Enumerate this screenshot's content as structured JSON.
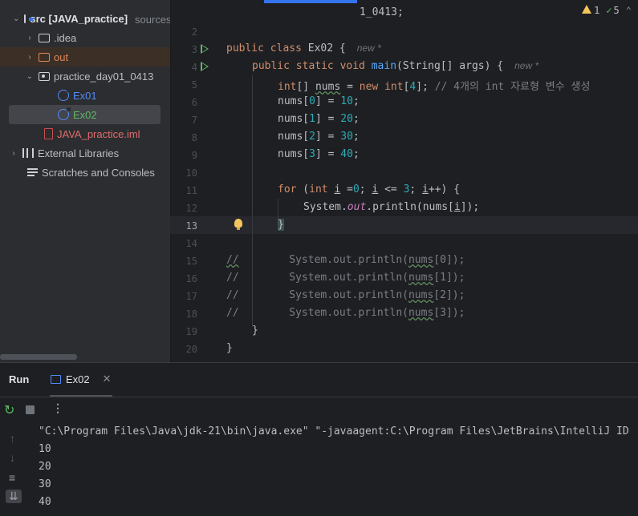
{
  "project_tree": {
    "items": [
      {
        "label": "src [JAVA_practice]",
        "extra": "sources root,  C:\\박세현\\JAVA_practice\\src",
        "type": "src-folder",
        "expanded": true
      },
      {
        "label": ".idea",
        "type": "folder",
        "expanded": false
      },
      {
        "label": "out",
        "type": "excluded-folder",
        "expanded": false
      },
      {
        "label": "practice_day01_0413",
        "type": "package",
        "expanded": true
      },
      {
        "label": "Ex01",
        "type": "class"
      },
      {
        "label": "Ex02",
        "type": "class",
        "selected": true
      },
      {
        "label": "JAVA_practice.iml",
        "type": "iml"
      },
      {
        "label": "External Libraries",
        "type": "libraries",
        "expanded": false
      },
      {
        "label": "Scratches and Consoles",
        "type": "scratches"
      }
    ]
  },
  "editor": {
    "partial_top_text": "1_0413;",
    "warnings": {
      "count": "1",
      "ok_count": "5"
    },
    "current_line": 13,
    "line_numbers": [
      "2",
      "3",
      "4",
      "5",
      "6",
      "7",
      "8",
      "9",
      "10",
      "11",
      "12",
      "13",
      "14",
      "15",
      "16",
      "17",
      "18",
      "19",
      "20"
    ],
    "hints": {
      "class_new": "new *",
      "main_new": "new *"
    },
    "code": {
      "l3_kw": "public class",
      "l3_name": " Ex02 {",
      "l4_kw1": "public static void",
      "l4_fn": "main",
      "l4_rest": "(String[] args) {",
      "l5_type": "int",
      "l5_a": "[] ",
      "l5_var": "nums",
      "l5_b": " = ",
      "l5_new": "new",
      "l5_int": "int",
      "l5_c": "[",
      "l5_num": "4",
      "l5_d": "]; ",
      "l5_cmt": "// 4개의 int 자료형 변수 생성",
      "l6_a": "nums[",
      "l6_i": "0",
      "l6_b": "] = ",
      "l6_v": "10",
      "l6_c": ";",
      "l7_a": "nums[",
      "l7_i": "1",
      "l7_b": "] = ",
      "l7_v": "20",
      "l7_c": ";",
      "l8_a": "nums[",
      "l8_i": "2",
      "l8_b": "] = ",
      "l8_v": "30",
      "l8_c": ";",
      "l9_a": "nums[",
      "l9_i": "3",
      "l9_b": "] = ",
      "l9_v": "40",
      "l9_c": ";",
      "l11_for": "for",
      "l11_a": " (",
      "l11_int": "int",
      "l11_b": " ",
      "l11_i1": "i",
      "l11_c": " =",
      "l11_n0": "0",
      "l11_d": "; ",
      "l11_i2": "i",
      "l11_e": " <= ",
      "l11_n3": "3",
      "l11_f": "; ",
      "l11_i3": "i",
      "l11_g": "++) {",
      "l12_a": "System.",
      "l12_out": "out",
      "l12_b": ".println(nums[",
      "l12_i": "i",
      "l12_c": "]);",
      "l13": "}",
      "l15_slash": "//",
      "l15_a": "        System.out.println(",
      "l15_v": "nums",
      "l15_b": "[0]);",
      "l16_slash": "//",
      "l16_a": "        System.out.println(",
      "l16_v": "nums",
      "l16_b": "[1]);",
      "l17_slash": "//",
      "l17_a": "        System.out.println(",
      "l17_v": "nums",
      "l17_b": "[2]);",
      "l18_slash": "//",
      "l18_a": "        System.out.println(",
      "l18_v": "nums",
      "l18_b": "[3]);",
      "l19": "}",
      "l20": "}"
    }
  },
  "run_window": {
    "title": "Run",
    "tab_label": "Ex02",
    "console": [
      "\"C:\\Program Files\\Java\\jdk-21\\bin\\java.exe\" \"-javaagent:C:\\Program Files\\JetBrains\\IntelliJ ID",
      "10",
      "20",
      "30",
      "40"
    ]
  },
  "colors": {
    "accent": "#3574f0",
    "keyword": "#cf8e6d",
    "number": "#2aacb8",
    "function": "#56a8f5",
    "comment": "#7a7e85",
    "excluded_folder": "#e08855",
    "iml_file": "#c94f4f"
  }
}
